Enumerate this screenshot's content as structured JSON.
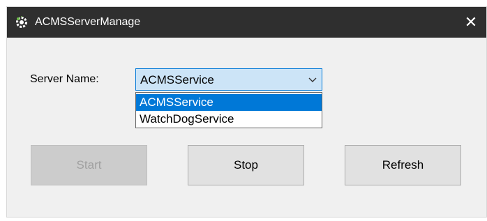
{
  "window": {
    "title": "ACMSServerManage",
    "close_label": "✕"
  },
  "form": {
    "server_name_label": "Server Name:",
    "selected_value": "ACMSService",
    "options": [
      "ACMSService",
      "WatchDogService"
    ],
    "highlighted_index": 0
  },
  "buttons": {
    "start_label": "Start",
    "start_enabled": false,
    "stop_label": "Stop",
    "refresh_label": "Refresh"
  },
  "icons": {
    "app": "gear-icon",
    "close": "close-icon",
    "dropdown": "chevron-down-icon"
  },
  "colors": {
    "titlebar": "#2f2f2f",
    "accent": "#0078d7"
  }
}
